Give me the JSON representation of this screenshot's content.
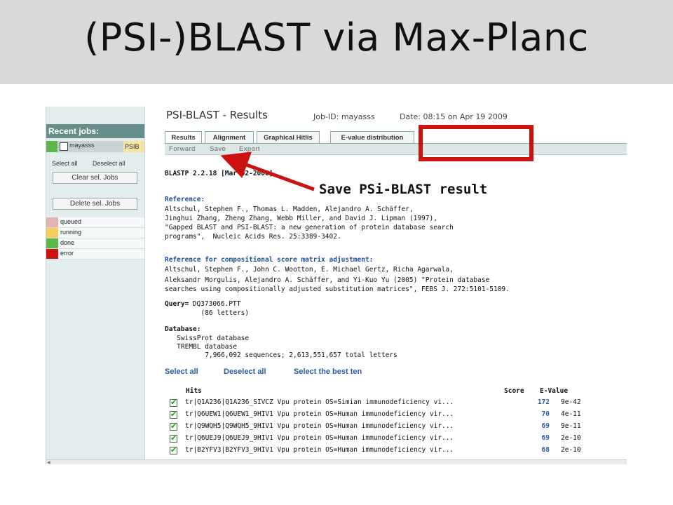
{
  "slide": {
    "title": "(PSI-)BLAST via Max-Planc"
  },
  "sidebar": {
    "recent_jobs_label": "Recent jobs:",
    "job": {
      "name": "mayasss",
      "type": "PSIB",
      "status_color": "#5cb64b"
    },
    "select_all": "Select all",
    "deselect_all": "Deselect all",
    "clear_button": "Clear sel. Jobs",
    "delete_button": "Delete sel. Jobs",
    "legend": [
      {
        "label": "queued",
        "color": "#e2b3b3"
      },
      {
        "label": "running",
        "color": "#f6cd5a"
      },
      {
        "label": "done",
        "color": "#5cb64b"
      },
      {
        "label": "error",
        "color": "#cc1111"
      }
    ]
  },
  "header": {
    "title": "PSI-BLAST - Results",
    "job_id": "Job-ID: mayasss",
    "date": "Date: 08:15 on Apr 19 2009"
  },
  "tabs": [
    "Results",
    "Alignment",
    "Graphical Hitlis",
    "E-value distribution"
  ],
  "subbar": [
    "Forward",
    "Save",
    "Export"
  ],
  "report": {
    "version": "BLASTP 2.2.18 [Mar-02-2008]",
    "reference_label": "Reference:",
    "reference_lines": [
      "Altschul, Stephen F., Thomas L. Madden, Alejandro A. Schäffer,",
      "Jinghui Zhang, Zheng Zhang, Webb Miller, and David J. Lipman (1997),",
      "\"Gapped BLAST and PSI-BLAST: a new generation of protein database search",
      "programs\",  Nucleic Acids Res. 25:3389-3402."
    ],
    "comp_reference_label": "Reference for compositional score matrix adjustment:",
    "comp_reference_lines": [
      "Altschul, Stephen F., John C. Wootton, E. Michael Gertz, Richa Agarwala,",
      "Aleksandr Morgulis, Alejandro A. Schäffer, and Yi-Kuo Yu (2005) \"Protein database",
      "searches using compositionally adjusted substitution matrices\", FEBS J. 272:5101-5109."
    ],
    "query_label": "Query=",
    "query_value": " DQ373066.PTT",
    "query_letters": "         (86 letters)",
    "database_label": "Database:",
    "database_lines": [
      "   SwissProt database",
      "   TREMBL database",
      "          7,966,092 sequences; 2,613,551,657 total letters"
    ]
  },
  "selection": {
    "select_all": "Select all",
    "deselect_all": "Deselect all",
    "select_best": "Select the best ten"
  },
  "hits_table": {
    "headers": {
      "hits": "Hits",
      "score": "Score",
      "evalue": "E-Value"
    },
    "rows": [
      {
        "desc": "tr|Q1A236|Q1A236_SIVCZ Vpu protein OS=Simian immunodeficiency vi...",
        "score": "172",
        "evalue": "9e-42"
      },
      {
        "desc": "tr|Q6UEW1|Q6UEW1_9HIV1 Vpu protein OS=Human immunodeficiency vir...",
        "score": "70",
        "evalue": "4e-11"
      },
      {
        "desc": "tr|Q9WQH5|Q9WQH5_9HIV1 Vpu protein OS=Human immunodeficiency vir...",
        "score": "69",
        "evalue": "9e-11"
      },
      {
        "desc": "tr|Q6UEJ9|Q6UEJ9_9HIV1 Vpu protein OS=Human immunodeficiency vir...",
        "score": "69",
        "evalue": "2e-10"
      },
      {
        "desc": "tr|B2YFV3|B2YFV3_9HIV1 Vpu protein OS=Human immunodeficiency vir...",
        "score": "68",
        "evalue": "2e-10"
      }
    ]
  },
  "annotation": {
    "text": "Save PSi-BLAST result",
    "color": "#cc1111"
  }
}
